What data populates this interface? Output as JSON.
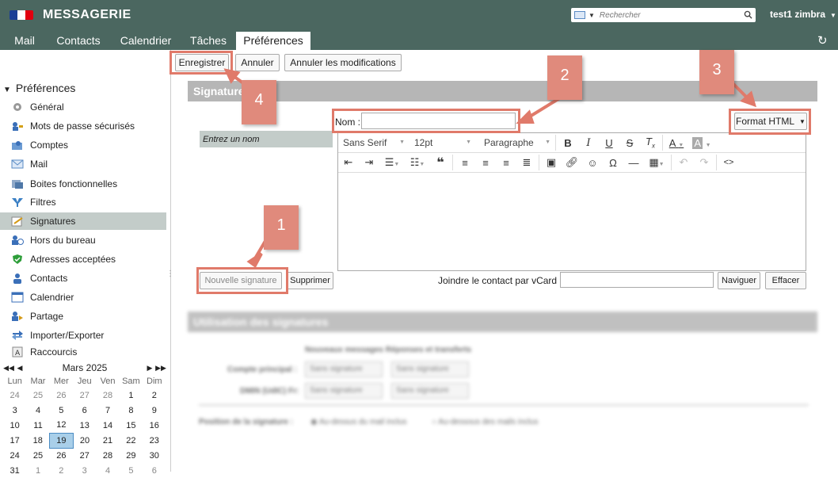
{
  "header": {
    "brand": "MESSAGERIE",
    "search_placeholder": "Rechercher",
    "user": "test1 zimbra"
  },
  "tabs": [
    "Mail",
    "Contacts",
    "Calendrier",
    "Tâches",
    "Préférences"
  ],
  "active_tab": "Préférences",
  "sidebar": {
    "title": "Préférences",
    "items": [
      {
        "label": "Général",
        "icon": "gear-icon"
      },
      {
        "label": "Mots de passe sécurisés",
        "icon": "key-users-icon"
      },
      {
        "label": "Comptes",
        "icon": "accounts-icon"
      },
      {
        "label": "Mail",
        "icon": "mail-icon"
      },
      {
        "label": "Boites fonctionnelles",
        "icon": "shared-mailbox-icon"
      },
      {
        "label": "Filtres",
        "icon": "filter-icon"
      },
      {
        "label": "Signatures",
        "icon": "signature-icon"
      },
      {
        "label": "Hors du bureau",
        "icon": "out-of-office-icon"
      },
      {
        "label": "Adresses acceptées",
        "icon": "shield-check-icon"
      },
      {
        "label": "Contacts",
        "icon": "contact-icon"
      },
      {
        "label": "Calendrier",
        "icon": "calendar-icon"
      },
      {
        "label": "Partage",
        "icon": "share-icon"
      },
      {
        "label": "Importer/Exporter",
        "icon": "import-export-icon"
      },
      {
        "label": "Raccourcis",
        "icon": "shortcut-icon"
      }
    ],
    "selected": "Signatures"
  },
  "calendar": {
    "month": "Mars 2025",
    "weekdays": [
      "Lun",
      "Mar",
      "Mer",
      "Jeu",
      "Ven",
      "Sam",
      "Dim"
    ],
    "weeks": [
      [
        "24",
        "25",
        "26",
        "27",
        "28",
        "1",
        "2"
      ],
      [
        "3",
        "4",
        "5",
        "6",
        "7",
        "8",
        "9"
      ],
      [
        "10",
        "11",
        "12",
        "13",
        "14",
        "15",
        "16"
      ],
      [
        "17",
        "18",
        "19",
        "20",
        "21",
        "22",
        "23"
      ],
      [
        "24",
        "25",
        "26",
        "27",
        "28",
        "29",
        "30"
      ],
      [
        "31",
        "1",
        "2",
        "3",
        "4",
        "5",
        "6"
      ]
    ],
    "today": "19"
  },
  "toolbar": {
    "save": "Enregistrer",
    "cancel": "Annuler",
    "revert": "Annuler les modifications"
  },
  "signature_section": {
    "title": "Signatures",
    "placeholder_item": "Entrez un nom",
    "name_label": "Nom :",
    "format": "Format HTML",
    "font": "Sans Serif",
    "size": "12pt",
    "paragraph": "Paragraphe",
    "new_signature": "Nouvelle signature",
    "delete": "Supprimer",
    "vcard_label": "Joindre le contact par vCard :",
    "browse": "Naviguer",
    "clear": "Effacer"
  },
  "usage_section": {
    "title": "Utilisation des signatures",
    "col_header": "Nouveaux messages   Réponses et transferts",
    "row1": "Compte principal :",
    "row2": "DMIN (UdIC) Fr:",
    "no_signature": "Sans signature",
    "position_label": "Position de la signature :",
    "opt_above": "Au-dessus du mail inclus",
    "opt_below": "Au-dessous des mails inclus"
  },
  "callouts": [
    "1",
    "2",
    "3",
    "4"
  ],
  "colors": {
    "header_bg": "#4b6760",
    "callout": "#e08a7c",
    "box": "#e07a6a"
  }
}
